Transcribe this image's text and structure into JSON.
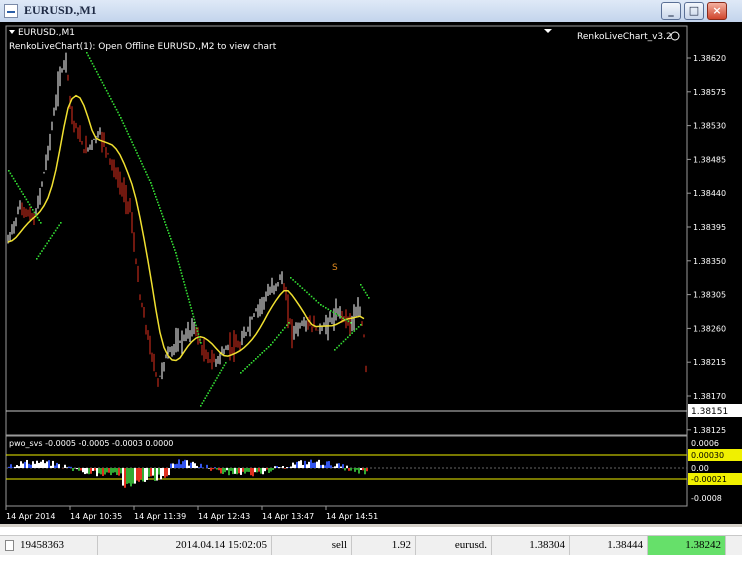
{
  "window": {
    "title": "EURUSD.,M1",
    "minimize_label": "_",
    "maximize_label": "□",
    "close_label": "×"
  },
  "chart": {
    "symbol_label": "EURUSD.,M1",
    "info_text": "RenkoLiveChart(1): Open Offline EURUSD.,M2 to view chart",
    "indicator_name": "RenkoLiveChart_v3.2",
    "signal_label": "S",
    "current_price": "1.38151",
    "price_ticks": [
      "1.38620",
      "1.38575",
      "1.38530",
      "1.38485",
      "1.38440",
      "1.38395",
      "1.38350",
      "1.38305",
      "1.38260",
      "1.38215",
      "1.38170",
      "1.38125"
    ],
    "sub_label": "pwo_svs -0.0005 -0.0005 -0.0003 0.0000",
    "sub_ticks": [
      "0.0006",
      "0.00",
      "-0.0008"
    ],
    "sub_level_high": "0.00030",
    "sub_level_low": "-0.00021",
    "time_labels": [
      "14 Apr 2014",
      "14 Apr 10:35",
      "14 Apr 11:39",
      "14 Apr 12:43",
      "14 Apr 13:47",
      "14 Apr 14:51"
    ],
    "colors": {
      "background": "#000000",
      "bull_candle": "#ffffff",
      "bear_candle": "#e0301e",
      "moving_average": "#f0e030",
      "trail_dots": "#33dd33",
      "signal": "#e08a1e",
      "level_highlight": "#f0f000"
    }
  },
  "status_bar": {
    "order_id": "19458363",
    "time": "2014.04.14 15:02:05",
    "type": "sell",
    "size": "1.92",
    "symbol": "eurusd.",
    "price": "1.38304",
    "sl": "1.38444",
    "current": "1.38242"
  }
}
